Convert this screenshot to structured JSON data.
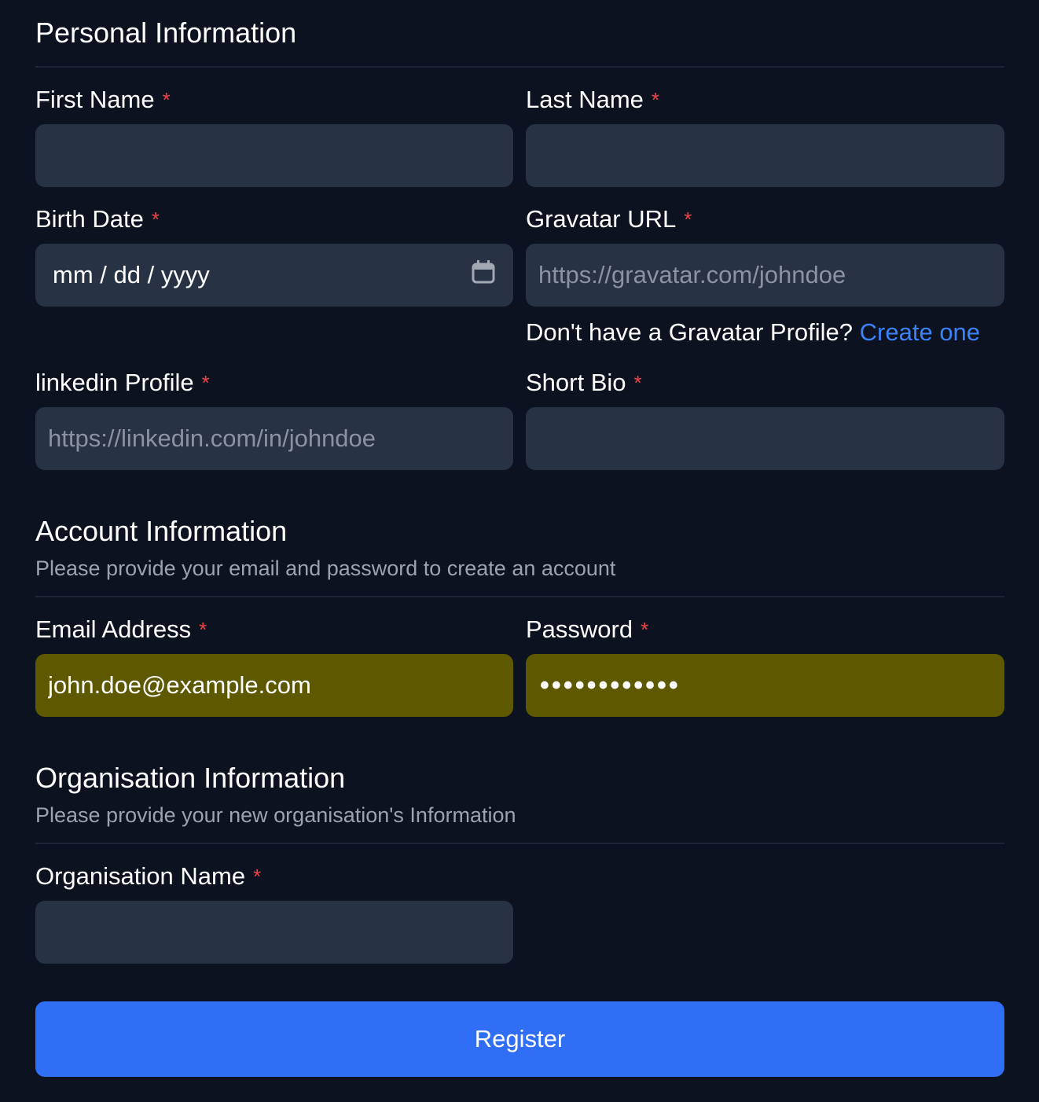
{
  "personal": {
    "title": "Personal Information",
    "first_name": {
      "label": "First Name",
      "value": ""
    },
    "last_name": {
      "label": "Last Name",
      "value": ""
    },
    "birth_date": {
      "label": "Birth Date",
      "placeholder": "mm / dd / yyyy"
    },
    "gravatar": {
      "label": "Gravatar URL",
      "placeholder": "https://gravatar.com/johndoe",
      "helper": "Don't have a Gravatar Profile?",
      "link": "Create one"
    },
    "linkedin": {
      "label": "linkedin Profile",
      "placeholder": "https://linkedin.com/in/johndoe"
    },
    "bio": {
      "label": "Short Bio",
      "value": ""
    }
  },
  "account": {
    "title": "Account Information",
    "subtitle": "Please provide your email and password to create an account",
    "email": {
      "label": "Email Address",
      "value": "john.doe@example.com"
    },
    "password": {
      "label": "Password",
      "value": "............"
    }
  },
  "organisation": {
    "title": "Organisation Information",
    "subtitle": "Please provide your new organisation's Information",
    "name": {
      "label": "Organisation Name",
      "value": ""
    }
  },
  "required_mark": "*",
  "register_label": "Register",
  "colors": {
    "background": "#0c1220",
    "input": "#273245",
    "autofill": "#5e5800",
    "primary": "#306ff5",
    "required": "#ef4444"
  }
}
